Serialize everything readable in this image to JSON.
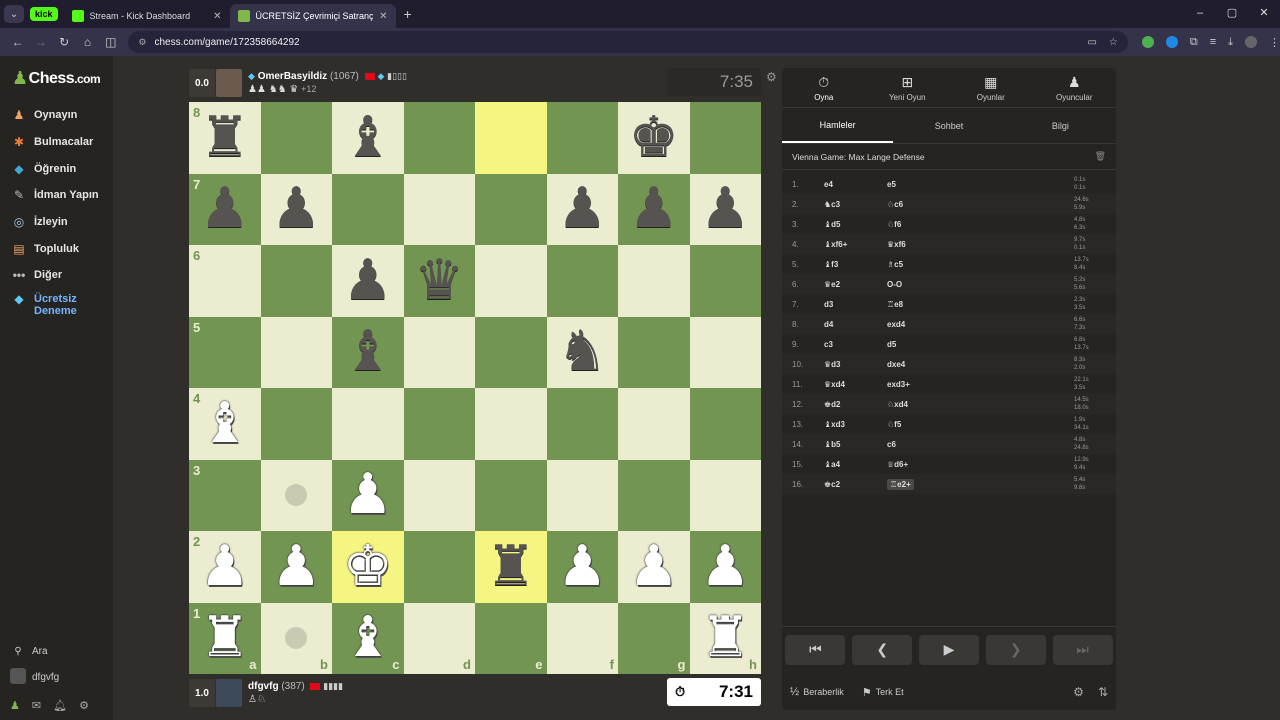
{
  "browser": {
    "menu_icon": "chevron-down-icon",
    "tabs": [
      {
        "label": "kick",
        "badge": true
      },
      {
        "label": "Stream - Kick Dashboard",
        "color": "#53fc18"
      },
      {
        "label": "ÜCRETSİZ Çevrimiçi Satranç Oy",
        "color": "#81b64c",
        "active": true
      }
    ],
    "url": "chess.com/game/172358664292"
  },
  "sidebar": {
    "logo": "Chess",
    "logo_suffix": ".com",
    "items": [
      {
        "label": "Oynayın",
        "icon": "play-icon"
      },
      {
        "label": "Bulmacalar",
        "icon": "puzzle-icon"
      },
      {
        "label": "Öğrenin",
        "icon": "learn-icon"
      },
      {
        "label": "İdman Yapın",
        "icon": "train-icon"
      },
      {
        "label": "İzleyin",
        "icon": "watch-icon"
      },
      {
        "label": "Topluluk",
        "icon": "community-icon"
      },
      {
        "label": "Diğer",
        "icon": "more-icon"
      }
    ],
    "premium": {
      "line1": "Ücretsiz",
      "line2": "Deneme"
    },
    "search": "Ara",
    "username": "dfgvfg"
  },
  "top_player": {
    "score": "0.0",
    "name": "OmerBasyildiz",
    "rating": "(1067)",
    "captured": "♟♟ ♞♞ ♛",
    "advantage": "+12",
    "clock": "7:35"
  },
  "bottom_player": {
    "score": "1.0",
    "name": "dfgvfg",
    "rating": "(387)",
    "captured": "♙♘",
    "clock": "7:31"
  },
  "board": {
    "ranks": [
      "8",
      "7",
      "6",
      "5",
      "4",
      "3",
      "2",
      "1"
    ],
    "files": [
      "a",
      "b",
      "c",
      "d",
      "e",
      "f",
      "g",
      "h"
    ],
    "position": [
      [
        "br",
        "",
        "bb",
        "",
        "",
        "",
        "bk",
        ""
      ],
      [
        "bp",
        "bp",
        "",
        "",
        "",
        "bp",
        "bp",
        "bp"
      ],
      [
        "",
        "",
        "bp",
        "bq",
        "",
        "",
        "",
        ""
      ],
      [
        "",
        "",
        "bb",
        "",
        "",
        "bn",
        "",
        ""
      ],
      [
        "wb",
        "",
        "",
        "",
        "",
        "",
        "",
        ""
      ],
      [
        "",
        "",
        "wp",
        "",
        "",
        "",
        "",
        ""
      ],
      [
        "wp",
        "wp",
        "wk",
        "",
        "br",
        "wp",
        "wp",
        "wp"
      ],
      [
        "wr",
        "",
        "wb",
        "",
        "",
        "",
        "",
        "wr"
      ]
    ],
    "highlights": [
      "e8",
      "e2",
      "c2"
    ],
    "hints": [
      "b3",
      "b1"
    ]
  },
  "panel": {
    "tabs": [
      {
        "label": "Oyna",
        "icon": "stopwatch-icon"
      },
      {
        "label": "Yeni Oyun",
        "icon": "plus-icon"
      },
      {
        "label": "Oyunlar",
        "icon": "board-icon"
      },
      {
        "label": "Oyuncular",
        "icon": "players-icon"
      }
    ],
    "subtabs": [
      "Hamleler",
      "Sohbet",
      "Bilgi"
    ],
    "opening": "Vienna Game: Max Lange Defense",
    "moves": [
      {
        "no": "1.",
        "w": "e4",
        "b": "e5",
        "tw": "0.1s",
        "tb": "0.1s"
      },
      {
        "no": "2.",
        "w": "♞c3",
        "b": "♘c6",
        "tw": "24.6s",
        "tb": "5.9s"
      },
      {
        "no": "3.",
        "w": "♝d5",
        "b": "♘f6",
        "tw": "4.8s",
        "tb": "6.3s"
      },
      {
        "no": "4.",
        "w": "♝xf6+",
        "b": "♛xf6",
        "tw": "9.7s",
        "tb": "0.1s"
      },
      {
        "no": "5.",
        "w": "♝f3",
        "b": "♗c5",
        "tw": "13.7s",
        "tb": "8.4s"
      },
      {
        "no": "6.",
        "w": "♛e2",
        "b": "O-O",
        "tw": "5.2s",
        "tb": "5.6s"
      },
      {
        "no": "7.",
        "w": "d3",
        "b": "♖e8",
        "tw": "2.3s",
        "tb": "3.5s"
      },
      {
        "no": "8.",
        "w": "d4",
        "b": "exd4",
        "tw": "6.6s",
        "tb": "7.3s"
      },
      {
        "no": "9.",
        "w": "c3",
        "b": "d5",
        "tw": "6.8s",
        "tb": "13.7s"
      },
      {
        "no": "10.",
        "w": "♛d3",
        "b": "dxe4",
        "tw": "8.3s",
        "tb": "2.0s"
      },
      {
        "no": "11.",
        "w": "♛xd4",
        "b": "exd3+",
        "tw": "22.1s",
        "tb": "3.5s"
      },
      {
        "no": "12.",
        "w": "♚d2",
        "b": "♘xd4",
        "tw": "14.5s",
        "tb": "18.0s"
      },
      {
        "no": "13.",
        "w": "♝xd3",
        "b": "♘f5",
        "tw": "1.9s",
        "tb": "34.1s"
      },
      {
        "no": "14.",
        "w": "♝b5",
        "b": "c6",
        "tw": "4.8s",
        "tb": "24.8s"
      },
      {
        "no": "15.",
        "w": "♝a4",
        "b": "♕d6+",
        "tw": "12.9s",
        "tb": "9.4s"
      },
      {
        "no": "16.",
        "w": "♚c2",
        "b": "♖e2+",
        "tw": "5.4s",
        "tb": "9.8s"
      }
    ],
    "footer": {
      "draw": "Beraberlik",
      "draw_prefix": "½",
      "resign": "Terk Et"
    }
  },
  "colors": {
    "light_square": "#ebecd0",
    "dark_square": "#739552",
    "highlight": "#f5f682",
    "accent": "#81b64c"
  }
}
